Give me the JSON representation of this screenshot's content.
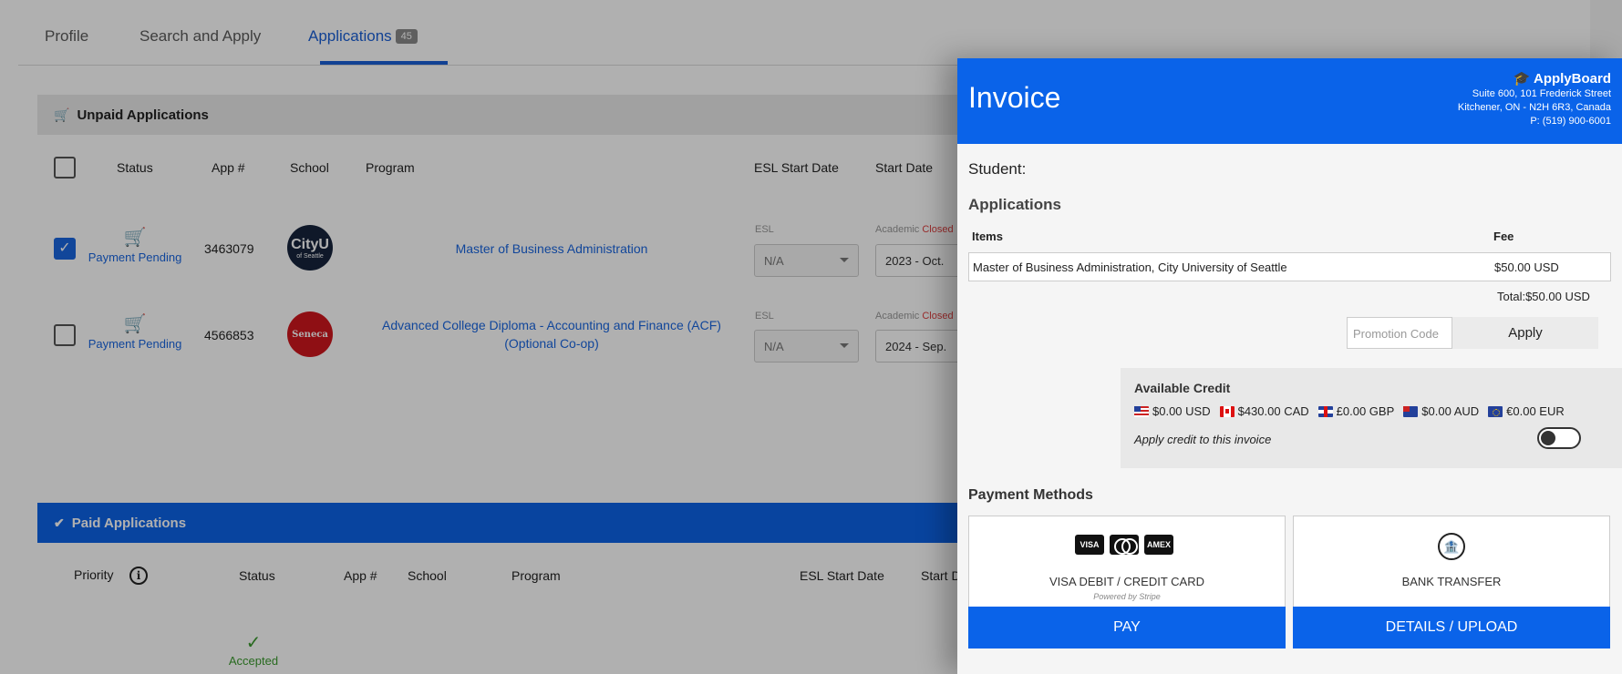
{
  "tabs": [
    {
      "label": "Profile"
    },
    {
      "label": "Search and Apply"
    },
    {
      "label": "Applications",
      "badge": "45"
    }
  ],
  "unpaid": {
    "title": "Unpaid Applications",
    "columns": [
      "Status",
      "App #",
      "School",
      "Program",
      "ESL Start Date",
      "Start Date"
    ],
    "rows": [
      {
        "status": "Payment Pending",
        "app": "3463079",
        "logo_text": "CityU",
        "logo_sub": "of Seattle",
        "program": "Master of Business Administration",
        "esl_label": "ESL",
        "esl_value": "N/A",
        "academic_label": "Academic",
        "closed": "Closed",
        "date": "2023 - Oct."
      },
      {
        "status": "Payment Pending",
        "app": "4566853",
        "logo_text": "Seneca",
        "program": "Advanced College Diploma - Accounting and Finance (ACF) (Optional Co-op)",
        "esl_label": "ESL",
        "esl_value": "N/A",
        "academic_label": "Academic",
        "closed": "Closed",
        "date": "2024 - Sep."
      }
    ]
  },
  "paid": {
    "title": "Paid Applications",
    "columns": [
      "Priority",
      "Status",
      "App #",
      "School",
      "Program",
      "ESL Start Date",
      "Start D"
    ],
    "rows": [
      {
        "status": "Accepted"
      }
    ]
  },
  "invoice": {
    "title": "Invoice",
    "brand_name": "ApplyBoard",
    "address1": "Suite 600, 101 Frederick Street",
    "address2": "Kitchener, ON - N2H 6R3, Canada",
    "phone": "P: (519) 900-6001",
    "student_label": "Student:",
    "applications_title": "Applications",
    "items_header": "Items",
    "fee_header": "Fee",
    "item": "Master of Business Administration, City University of Seattle",
    "fee": "$50.00 USD",
    "total": "Total:$50.00 USD",
    "promo_placeholder": "Promotion Code",
    "apply_label": "Apply",
    "credit_title": "Available Credit",
    "credits": [
      "$0.00 USD",
      "$430.00 CAD",
      "£0.00 GBP",
      "$0.00 AUD",
      "€0.00 EUR"
    ],
    "credit_apply_label": "Apply credit to this invoice",
    "payment_methods_title": "Payment Methods",
    "card_label": "VISA DEBIT / CREDIT CARD",
    "card_powered": "Powered by Stripe",
    "card_logos": [
      "VISA",
      "",
      "AMEX"
    ],
    "bank_label": "BANK TRANSFER",
    "pay_label": "PAY",
    "details_label": "DETAILS / UPLOAD"
  },
  "colors": {
    "primary": "#0a63e9",
    "link": "#1a66e0",
    "accepted": "#3a9a2e",
    "closed": "#e04040"
  }
}
